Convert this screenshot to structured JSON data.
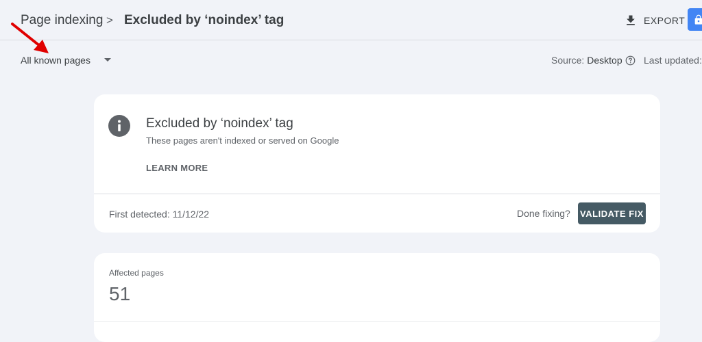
{
  "breadcrumb": {
    "parent": "Page indexing",
    "separator": ">",
    "current": "Excluded by ‘noindex’ tag"
  },
  "toolbar": {
    "export_label": "EXPORT",
    "export_icon": "download-icon",
    "share_icon": "lock-icon",
    "accent_color": "#4285f4"
  },
  "filter": {
    "selected": "All known pages",
    "icon": "dropdown-arrow-icon"
  },
  "annotation": {
    "icon": "red-arrow-pointer",
    "color": "#e00000"
  },
  "source": {
    "label": "Source:",
    "value": "Desktop",
    "icon": "help-icon"
  },
  "last_updated": {
    "label": "Last updated:"
  },
  "issue": {
    "icon": "info-icon",
    "title": "Excluded by ‘noindex’ tag",
    "description": "These pages aren't indexed or served on Google",
    "learn_more": "LEARN MORE",
    "first_detected": "First detected: 11/12/22",
    "done_fixing": "Done fixing?",
    "validate_label": "VALIDATE FIX",
    "validate_color": "#455a64"
  },
  "affected": {
    "label": "Affected pages",
    "value": "51"
  }
}
